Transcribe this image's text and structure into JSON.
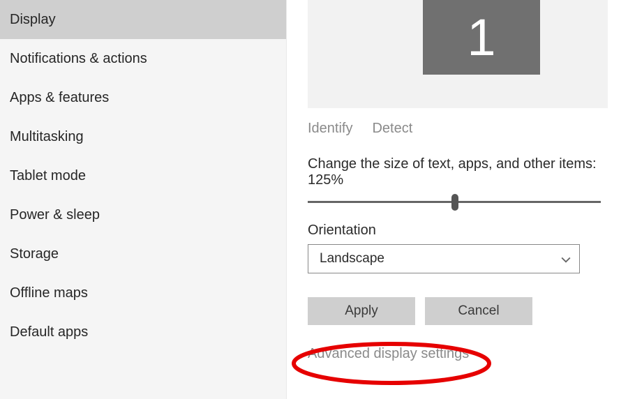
{
  "sidebar": {
    "items": [
      {
        "label": "Display",
        "name": "sidebar-item-display",
        "selected": true
      },
      {
        "label": "Notifications & actions",
        "name": "sidebar-item-notifications",
        "selected": false
      },
      {
        "label": "Apps & features",
        "name": "sidebar-item-apps-features",
        "selected": false
      },
      {
        "label": "Multitasking",
        "name": "sidebar-item-multitasking",
        "selected": false
      },
      {
        "label": "Tablet mode",
        "name": "sidebar-item-tablet-mode",
        "selected": false
      },
      {
        "label": "Power & sleep",
        "name": "sidebar-item-power-sleep",
        "selected": false
      },
      {
        "label": "Storage",
        "name": "sidebar-item-storage",
        "selected": false
      },
      {
        "label": "Offline maps",
        "name": "sidebar-item-offline-maps",
        "selected": false
      },
      {
        "label": "Default apps",
        "name": "sidebar-item-default-apps",
        "selected": false
      }
    ]
  },
  "main": {
    "monitor_number": "1",
    "identify_label": "Identify",
    "detect_label": "Detect",
    "scaling_text": "Change the size of text, apps, and other items: 125%",
    "orientation_label": "Orientation",
    "orientation_value": "Landscape",
    "apply_label": "Apply",
    "cancel_label": "Cancel",
    "advanced_link": "Advanced display settings"
  }
}
